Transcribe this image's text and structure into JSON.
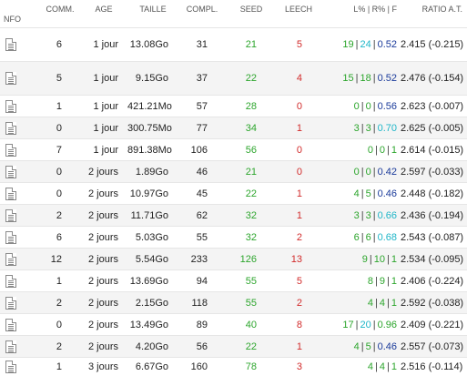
{
  "header": {
    "nfo": "NFO",
    "comm": "COMM.",
    "age": "AGE",
    "taille": "TAILLE",
    "compl": "COMPL.",
    "seed": "SEED",
    "leech": "LEECH",
    "ratio_pct": "L% | R% | F",
    "ratio": "RATIO A.T."
  },
  "rows": [
    {
      "comm": "6",
      "age": "1 jour",
      "taille": "13.08Go",
      "compl": "31",
      "seed": "21",
      "leech": "5",
      "l": "19",
      "r": "24",
      "f": "0.52",
      "ratio": "2.415 (-0.215)"
    },
    {
      "comm": "5",
      "age": "1 jour",
      "taille": "9.15Go",
      "compl": "37",
      "seed": "22",
      "leech": "4",
      "l": "15",
      "r": "18",
      "f": "0.52",
      "ratio": "2.476 (-0.154)"
    },
    {
      "comm": "1",
      "age": "1 jour",
      "taille": "421.21Mo",
      "compl": "57",
      "seed": "28",
      "leech": "0",
      "l": "0",
      "r": "0",
      "f": "0.56",
      "ratio": "2.623 (-0.007)"
    },
    {
      "comm": "0",
      "age": "1 jour",
      "taille": "300.75Mo",
      "compl": "77",
      "seed": "34",
      "leech": "1",
      "l": "3",
      "r": "3",
      "f": "0.70",
      "ratio": "2.625 (-0.005)"
    },
    {
      "comm": "7",
      "age": "1 jour",
      "taille": "891.38Mo",
      "compl": "106",
      "seed": "56",
      "leech": "0",
      "l": "0",
      "r": "0",
      "f": "1",
      "ratio": "2.614 (-0.015)"
    },
    {
      "comm": "0",
      "age": "2 jours",
      "taille": "1.89Go",
      "compl": "46",
      "seed": "21",
      "leech": "0",
      "l": "0",
      "r": "0",
      "f": "0.42",
      "ratio": "2.597 (-0.033)"
    },
    {
      "comm": "0",
      "age": "2 jours",
      "taille": "10.97Go",
      "compl": "45",
      "seed": "22",
      "leech": "1",
      "l": "4",
      "r": "5",
      "f": "0.46",
      "ratio": "2.448 (-0.182)"
    },
    {
      "comm": "2",
      "age": "2 jours",
      "taille": "11.71Go",
      "compl": "62",
      "seed": "32",
      "leech": "1",
      "l": "3",
      "r": "3",
      "f": "0.66",
      "ratio": "2.436 (-0.194)"
    },
    {
      "comm": "6",
      "age": "2 jours",
      "taille": "5.03Go",
      "compl": "55",
      "seed": "32",
      "leech": "2",
      "l": "6",
      "r": "6",
      "f": "0.68",
      "ratio": "2.543 (-0.087)"
    },
    {
      "comm": "12",
      "age": "2 jours",
      "taille": "5.54Go",
      "compl": "233",
      "seed": "126",
      "leech": "13",
      "l": "9",
      "r": "10",
      "f": "1",
      "ratio": "2.534 (-0.095)"
    },
    {
      "comm": "1",
      "age": "2 jours",
      "taille": "13.69Go",
      "compl": "94",
      "seed": "55",
      "leech": "5",
      "l": "8",
      "r": "9",
      "f": "1",
      "ratio": "2.406 (-0.224)"
    },
    {
      "comm": "2",
      "age": "2 jours",
      "taille": "2.15Go",
      "compl": "118",
      "seed": "55",
      "leech": "2",
      "l": "4",
      "r": "4",
      "f": "1",
      "ratio": "2.592 (-0.038)"
    },
    {
      "comm": "0",
      "age": "2 jours",
      "taille": "13.49Go",
      "compl": "89",
      "seed": "40",
      "leech": "8",
      "l": "17",
      "r": "20",
      "f": "0.96",
      "ratio": "2.409 (-0.221)"
    },
    {
      "comm": "2",
      "age": "2 jours",
      "taille": "4.20Go",
      "compl": "56",
      "seed": "22",
      "leech": "1",
      "l": "4",
      "r": "5",
      "f": "0.46",
      "ratio": "2.557 (-0.073)"
    },
    {
      "comm": "1",
      "age": "3 jours",
      "taille": "6.67Go",
      "compl": "160",
      "seed": "78",
      "leech": "3",
      "l": "4",
      "r": "4",
      "f": "1",
      "ratio": "2.516 (-0.114)"
    }
  ],
  "colors": {
    "seed": "#2ca52c",
    "leech": "#d22b2b",
    "l_pct": "#2ca52c",
    "r_pct_low": "#2ca52c",
    "r_pct_high": "#1fb6c8",
    "f_high": "#2ca52c",
    "f_mid": "#1fb6c8",
    "f_low": "#1a3a9a"
  },
  "icons": {
    "nfo": "document-icon"
  }
}
